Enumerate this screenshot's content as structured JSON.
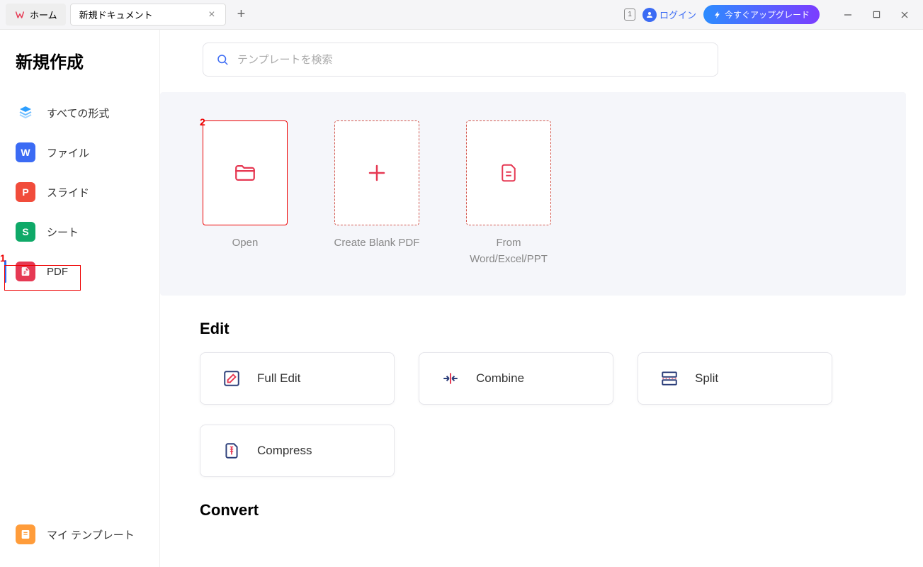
{
  "titlebar": {
    "home_label": "ホーム",
    "doc_tab_label": "新規ドキュメント",
    "badge": "1",
    "login_label": "ログイン",
    "upgrade_label": "今すぐアップグレード"
  },
  "sidebar": {
    "title": "新規作成",
    "items": [
      {
        "label": "すべての形式"
      },
      {
        "label": "ファイル"
      },
      {
        "label": "スライド"
      },
      {
        "label": "シート"
      },
      {
        "label": "PDF"
      }
    ],
    "bottom_label": "マイ テンプレート"
  },
  "search": {
    "placeholder": "テンプレートを検索"
  },
  "cards": [
    {
      "label": "Open"
    },
    {
      "label": "Create Blank PDF"
    },
    {
      "label": "From Word/Excel/PPT"
    }
  ],
  "sections": {
    "edit_title": "Edit",
    "edit_actions": [
      "Full Edit",
      "Combine",
      "Split",
      "Compress"
    ],
    "convert_title": "Convert"
  },
  "annotations": {
    "a1": "1",
    "a2": "2"
  }
}
